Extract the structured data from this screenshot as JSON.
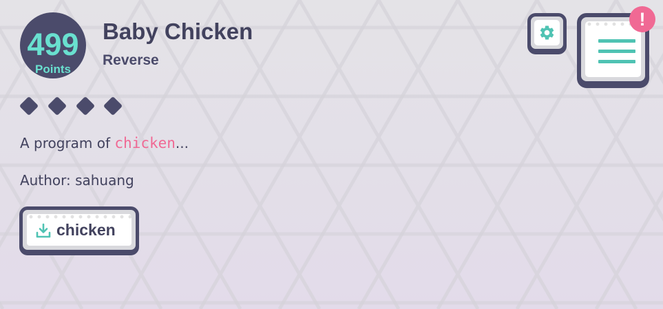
{
  "challenge": {
    "points": "499",
    "points_label": "Points",
    "title": "Baby Chicken",
    "category": "Reverse",
    "difficulty": 4,
    "description_prefix": "A program of ",
    "description_code": "chicken",
    "description_suffix": "...",
    "author": "Author: sahuang"
  },
  "attachment": {
    "label": "chicken",
    "icon": "download-icon"
  },
  "toolbar": {
    "settings_icon": "gear-icon",
    "menu_icon": "menu-icon",
    "alert_text": "!"
  },
  "colors": {
    "dark": "#4b4b6b",
    "teal": "#69e0cf",
    "accent_teal": "#4fc3b3",
    "pink": "#f06994",
    "text": "#42425e"
  }
}
